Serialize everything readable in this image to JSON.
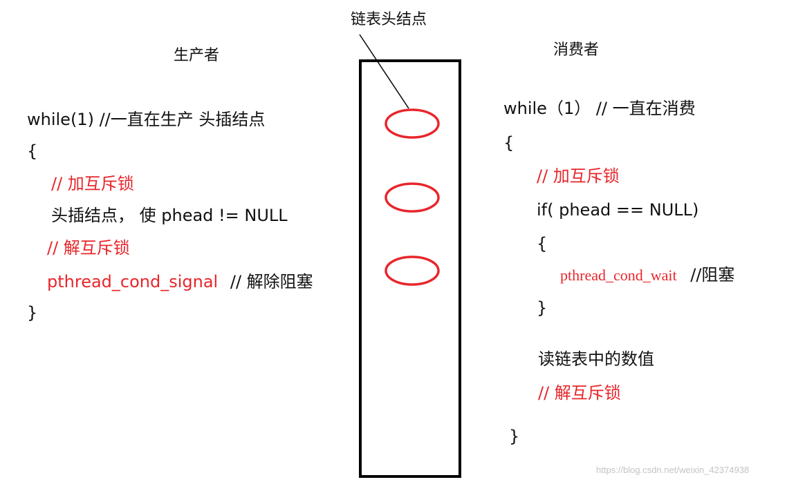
{
  "middle": {
    "label": "链表头结点"
  },
  "producer": {
    "title": "生产者",
    "lines": {
      "while": "while(1)  //一直在生产  头插结点",
      "open": "{",
      "lock": "// 加互斥锁",
      "insert": "头插结点，  使 phead != NULL",
      "unlock": "// 解互斥锁",
      "signal": "pthread_cond_signal",
      "signal_comment": "// 解除阻塞",
      "close": "}"
    }
  },
  "consumer": {
    "title": "消费者",
    "lines": {
      "while": "while（1）  // 一直在消费",
      "open": "{",
      "lock": "//  加互斥锁",
      "if": "if( phead == NULL)",
      "inner_open": "{",
      "wait": "pthread_cond_wait",
      "wait_comment": "//阻塞",
      "inner_close": "}",
      "read": "读链表中的数值",
      "unlock": "// 解互斥锁",
      "close": "}"
    }
  },
  "watermark": "https://blog.csdn.net/weixin_42374938",
  "colors": {
    "accent_red": "#e8262b",
    "text": "#111111",
    "watermark": "#c4c4c4"
  }
}
